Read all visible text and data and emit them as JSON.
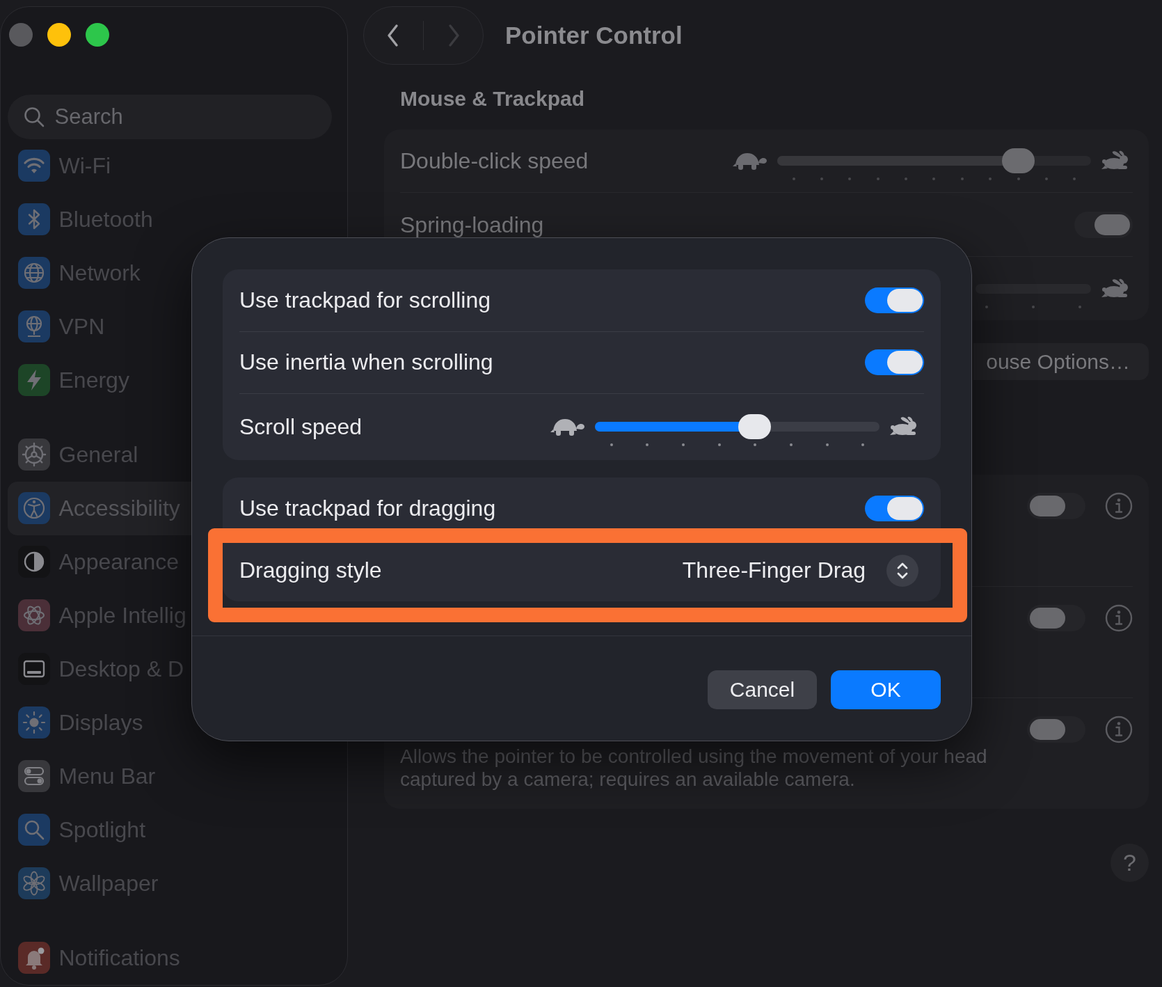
{
  "window": {
    "controls": [
      {
        "kind": "close",
        "disabled": true
      },
      {
        "kind": "minimize",
        "disabled": false
      },
      {
        "kind": "zoom",
        "disabled": false
      }
    ]
  },
  "sidebar": {
    "search": {
      "placeholder": "Search"
    },
    "sections": [
      {
        "items": [
          {
            "label": "Wi-Fi",
            "color": "#1b3a62",
            "selected": false
          },
          {
            "label": "Bluetooth",
            "color": "#1b3a62",
            "selected": false
          },
          {
            "label": "Network",
            "color": "#1b3a62",
            "selected": false
          },
          {
            "label": "VPN",
            "color": "#1b3a62",
            "selected": false
          },
          {
            "label": "Energy",
            "color": "#1d4527",
            "selected": false
          }
        ]
      },
      {
        "items": [
          {
            "label": "General",
            "color": "#38383c",
            "selected": false
          },
          {
            "label": "Accessibility",
            "color": "#1b3a62",
            "selected": true
          },
          {
            "label": "Appearance",
            "color": "#131315",
            "selected": false
          },
          {
            "label": "Apple Intellig",
            "color": "#4b2f38",
            "selected": false
          },
          {
            "label": "Desktop & D",
            "color": "#131315",
            "selected": false
          },
          {
            "label": "Displays",
            "color": "#1b3a62",
            "selected": false
          },
          {
            "label": "Menu Bar",
            "color": "#38383c",
            "selected": false
          },
          {
            "label": "Spotlight",
            "color": "#1b3a62",
            "selected": false
          },
          {
            "label": "Wallpaper",
            "color": "#1d3b5a",
            "selected": false
          }
        ]
      },
      {
        "items": [
          {
            "label": "Notifications",
            "color": "#5a2a27",
            "selected": false
          }
        ]
      }
    ]
  },
  "toolbar": {
    "nav": [
      {
        "kind": "back",
        "disabled": false
      },
      {
        "kind": "forward",
        "disabled": true
      }
    ],
    "title": "Pointer Control"
  },
  "content": {
    "section_title": "Mouse & Trackpad",
    "group": {
      "rows": [
        {
          "kind": "slider",
          "label": "Double-click speed",
          "level": 0.8
        },
        {
          "kind": "toggle",
          "label": "Spring-loading",
          "on": true
        },
        {
          "kind": "slider"
        }
      ]
    },
    "button": "ouse Options…",
    "options_group": {
      "rows": [
        {
          "on": false
        },
        {
          "on": false
        },
        {
          "on": false,
          "description": "Allows the pointer to be controlled using the movement of your head captured by a camera; requires an available camera."
        }
      ]
    }
  },
  "dialog": {
    "groups": [
      {
        "rows": [
          {
            "kind": "toggle",
            "label": "Use trackpad for scrolling",
            "on": true
          },
          {
            "kind": "toggle",
            "label": "Use inertia when scrolling",
            "on": true
          },
          {
            "kind": "slider",
            "label": "Scroll speed",
            "level": 0.57
          }
        ]
      },
      {
        "rows": [
          {
            "kind": "toggle",
            "label": "Use trackpad for dragging",
            "on": true
          },
          {
            "kind": "popup",
            "label": "Dragging style",
            "value": "Three-Finger Drag",
            "highlighted": true
          }
        ]
      }
    ],
    "buttons": [
      {
        "kind": "cancel",
        "label": "Cancel"
      },
      {
        "kind": "confirm",
        "label": "OK"
      }
    ]
  },
  "help_button": "?"
}
